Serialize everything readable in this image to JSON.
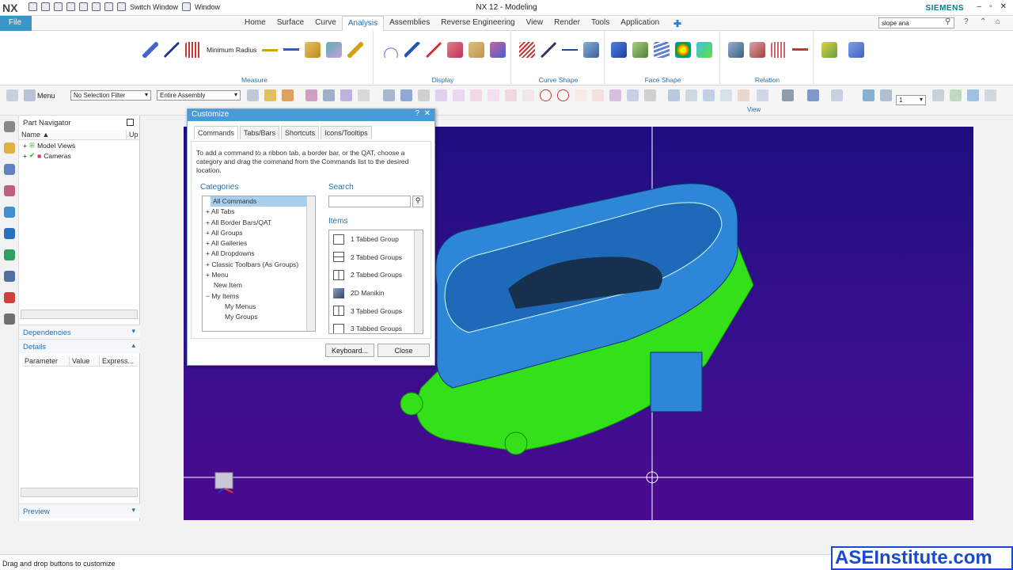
{
  "titlebar": {
    "logo": "NX",
    "switch_window": "Switch Window",
    "window_menu": "Window",
    "title": "NX 12 - Modeling",
    "brand": "SIEMENS"
  },
  "menubar": {
    "file": "File",
    "tabs": [
      "Home",
      "Surface",
      "Curve",
      "Analysis",
      "Assemblies",
      "Reverse Engineering",
      "View",
      "Render",
      "Tools",
      "Application"
    ],
    "active_tab": "Analysis",
    "search_value": "slope ana"
  },
  "ribbon": {
    "groups": [
      {
        "label": "Measure",
        "button": "Minimum Radius"
      },
      {
        "label": "Display"
      },
      {
        "label": "Curve Shape"
      },
      {
        "label": "Face Shape"
      },
      {
        "label": "Relation"
      }
    ]
  },
  "toolbar": {
    "menu": "Menu",
    "selection_filter": "No Selection Filter",
    "assembly_scope": "Entire Assembly",
    "view_label": "View",
    "layer_value": "1"
  },
  "navigator": {
    "title": "Part Navigator",
    "col_name": "Name",
    "col_up": "Up",
    "tree": [
      "Model Views",
      "Cameras"
    ],
    "dependencies": "Dependencies",
    "details": "Details",
    "detail_cols": [
      "Parameter",
      "Value",
      "Express..."
    ],
    "preview": "Preview"
  },
  "dialog": {
    "title": "Customize",
    "tabs": [
      "Commands",
      "Tabs/Bars",
      "Shortcuts",
      "Icons/Tooltips"
    ],
    "description": "To add a command to a ribbon tab, a border bar, or the QAT, choose a category and drag the command from the Commands list to the desired location.",
    "categories_label": "Categories",
    "categories": [
      "All Commands",
      "All Tabs",
      "All Border Bars/QAT",
      "All Groups",
      "All Galleries",
      "All Dropdowns",
      "Classic Toolbars (As Groups)",
      "Menu",
      "New Item",
      "My Items",
      "My Menus",
      "My Groups"
    ],
    "search_label": "Search",
    "items_label": "Items",
    "items": [
      "1 Tabbed Group",
      "2 Tabbed Groups",
      "2 Tabbed Groups",
      "2D Manikin",
      "3 Tabbed Groups",
      "3 Tabbed Groups"
    ],
    "keyboard_button": "Keyboard...",
    "close_button": "Close"
  },
  "status": {
    "text": "Drag and drop buttons to customize"
  },
  "watermark": "ASEInstitute.com",
  "colors": {
    "accent": "#3b95c8",
    "viewport_bg": "#2a0f88",
    "model_green": "#33e01a",
    "model_blue": "#2e86d8"
  }
}
